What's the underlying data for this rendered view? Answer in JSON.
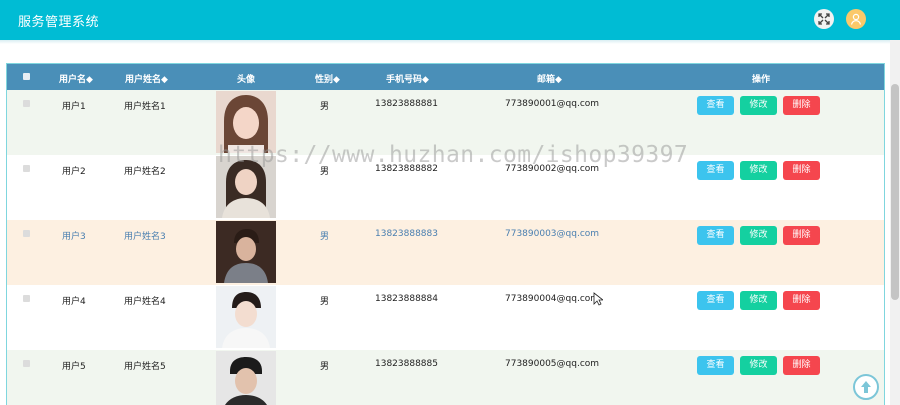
{
  "app": {
    "title": "服务管理系统"
  },
  "table": {
    "headers": {
      "username": "用户名◆",
      "realname": "用户姓名◆",
      "avatar": "头像",
      "gender": "性别◆",
      "phone": "手机号码◆",
      "email": "邮箱◆",
      "actions": "操作"
    },
    "rows": [
      {
        "username": "用户1",
        "realname": "用户姓名1",
        "gender": "男",
        "phone": "13823888881",
        "email": "773890001@qq.com"
      },
      {
        "username": "用户2",
        "realname": "用户姓名2",
        "gender": "男",
        "phone": "13823888882",
        "email": "773890002@qq.com"
      },
      {
        "username": "用户3",
        "realname": "用户姓名3",
        "gender": "男",
        "phone": "13823888883",
        "email": "773890003@qq.com"
      },
      {
        "username": "用户4",
        "realname": "用户姓名4",
        "gender": "男",
        "phone": "13823888884",
        "email": "773890004@qq.com"
      },
      {
        "username": "用户5",
        "realname": "用户姓名5",
        "gender": "男",
        "phone": "13823888885",
        "email": "773890005@qq.com"
      }
    ],
    "actions": {
      "view": "查看",
      "edit": "修改",
      "delete": "删除"
    }
  },
  "watermark": "https://www.huzhan.com/ishop39397",
  "colors": {
    "topbar": "#00bcd4",
    "header": "#4a8fb8",
    "row_alt": "#f1f6ef",
    "row_highlight": "#fdf0e1",
    "view": "#3cc4ee",
    "edit": "#14d0a0",
    "delete": "#f5464e"
  },
  "icons": {
    "fullscreen": "expand-icon",
    "user": "user-icon",
    "back_top": "arrow-up-icon"
  }
}
